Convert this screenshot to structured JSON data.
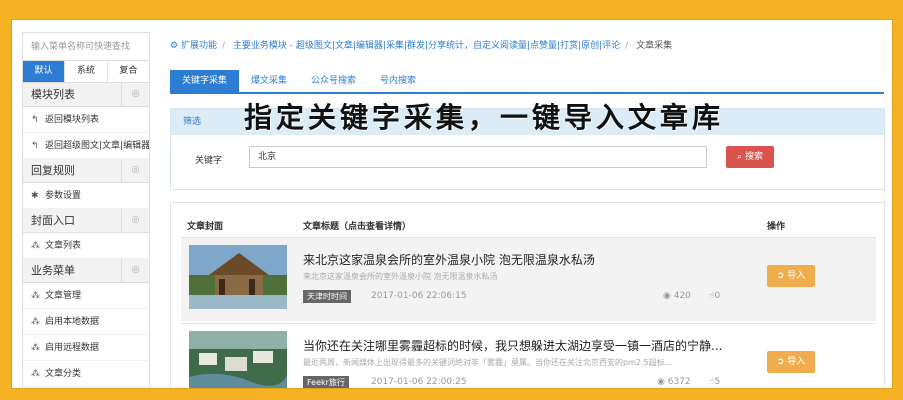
{
  "sidebar": {
    "search_placeholder": "输入菜单名称可快速查找",
    "tabs": [
      "默认",
      "系统",
      "复合"
    ],
    "groups": [
      {
        "title": "模块列表",
        "items": [
          "返回模块列表",
          "返回超级图文|文章|编辑器"
        ]
      },
      {
        "title": "回复规则",
        "items": [
          "参数设置"
        ]
      },
      {
        "title": "封面入口",
        "items": [
          "文章列表"
        ]
      },
      {
        "title": "业务菜单",
        "items": [
          "文章管理",
          "启用本地数据",
          "启用远程数据",
          "文章分类"
        ]
      }
    ]
  },
  "breadcrumb": [
    "扩展功能",
    "主要业务模块 - 超级图文|文章|编辑器|采集|群发|分享统计，自定义阅读量|点赞量|打赏|原创|评论",
    "文章采集"
  ],
  "tabs": [
    "关键字采集",
    "爆文采集",
    "公众号搜索",
    "号内搜索"
  ],
  "headline": "指定关键字采集，一键导入文章库",
  "filter": {
    "title": "筛选",
    "keyword_label": "关键字",
    "keyword_value": "北京",
    "search_label": "搜索"
  },
  "list": {
    "headers": {
      "cover": "文章封面",
      "title": "文章标题（点击查看详情）",
      "action": "操作"
    },
    "rows": [
      {
        "title": "来北京这家温泉会所的室外温泉小院 泡无限温泉水私汤",
        "desc": "来北京这家温泉会所的室外温泉小院 泡无限温泉水私汤",
        "tag": "天津时时间",
        "time": "2017-01-06 22:06:15",
        "views": "420",
        "likes": "0",
        "button": "导入"
      },
      {
        "title": "当你还在关注哪里雾霾超标的时候，我只想躲进太湖边享受一镇一酒店的宁静...",
        "desc": "最近两周，新闻媒体上出现得最多的关键词绝对非「雾霾」莫属。当你还在关注北京西安的pm2.5超标...",
        "tag": "Feekr旅行",
        "time": "2017-01-06 22:00:25",
        "views": "6372",
        "likes": "5",
        "button": "导入"
      }
    ]
  },
  "colors": {
    "primary": "#2d7dd2",
    "danger": "#d9534f",
    "warning": "#f0ad4e",
    "frame": "#f5b324"
  }
}
